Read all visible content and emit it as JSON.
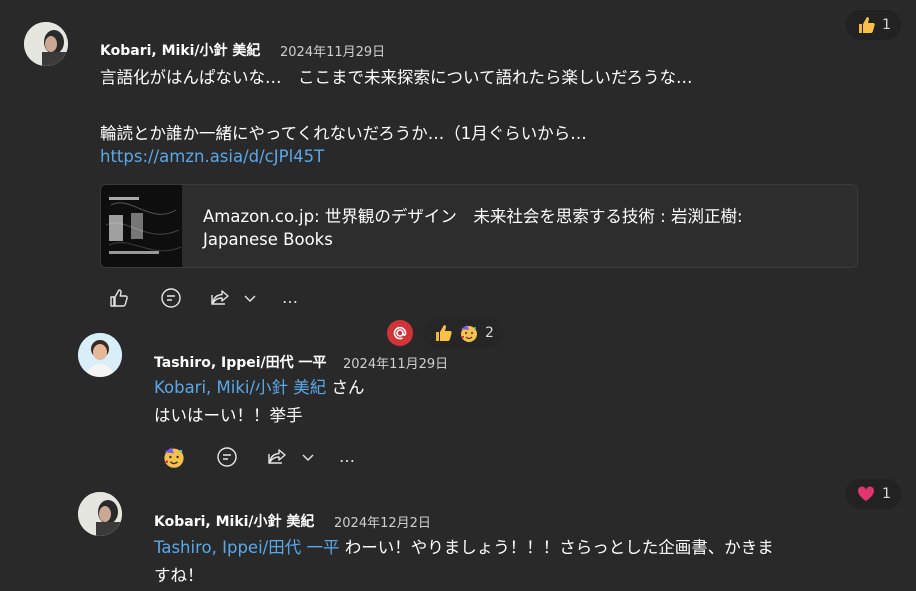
{
  "messages": [
    {
      "author": "Kobari, Miki/小針 美紀",
      "date": "2024年11月29日",
      "lines": [
        "言語化がはんぱないな…　ここまで未来探索について語れたら楽しいだろうな…",
        "輪読とか誰か一緒にやってくれないだろうか…（1月ぐらいから…"
      ],
      "link": "https://amzn.asia/d/cJPl45T",
      "preview": {
        "title_line1": "Amazon.co.jp: 世界観のデザイン　未来社会を思索する技術 : 岩渕正樹:",
        "title_line2": "Japanese Books"
      },
      "reaction": {
        "emoji_name": "thumbs-up-icon",
        "count": "1"
      }
    },
    {
      "author": "Tashiro, Ippei/田代 一平",
      "date": "2024年11月29日",
      "mention": "Kobari, Miki/小針 美紀",
      "mention_suffix": " さん",
      "line2": "はいはーい！！挙手",
      "reaction": {
        "emoji_name": "thumbs-up-icon",
        "emoji2_name": "party-face-icon",
        "count": "2"
      }
    },
    {
      "author": "Kobari, Miki/小針 美紀",
      "date": "2024年12月2日",
      "mention": "Tashiro, Ippei/田代 一平",
      "text_line1": " わーい！やりましょう！！！さらっとした企画書、かきま",
      "text_line2": "すね！",
      "reaction": {
        "emoji_name": "heart-icon",
        "count": "1"
      }
    }
  ],
  "icons": {
    "more": "…",
    "chevron": "chevron-down-icon"
  },
  "colors": {
    "background": "#292929",
    "link": "#5aa8e8",
    "mention_badge": "#d13438",
    "heart": "#e0366b"
  }
}
